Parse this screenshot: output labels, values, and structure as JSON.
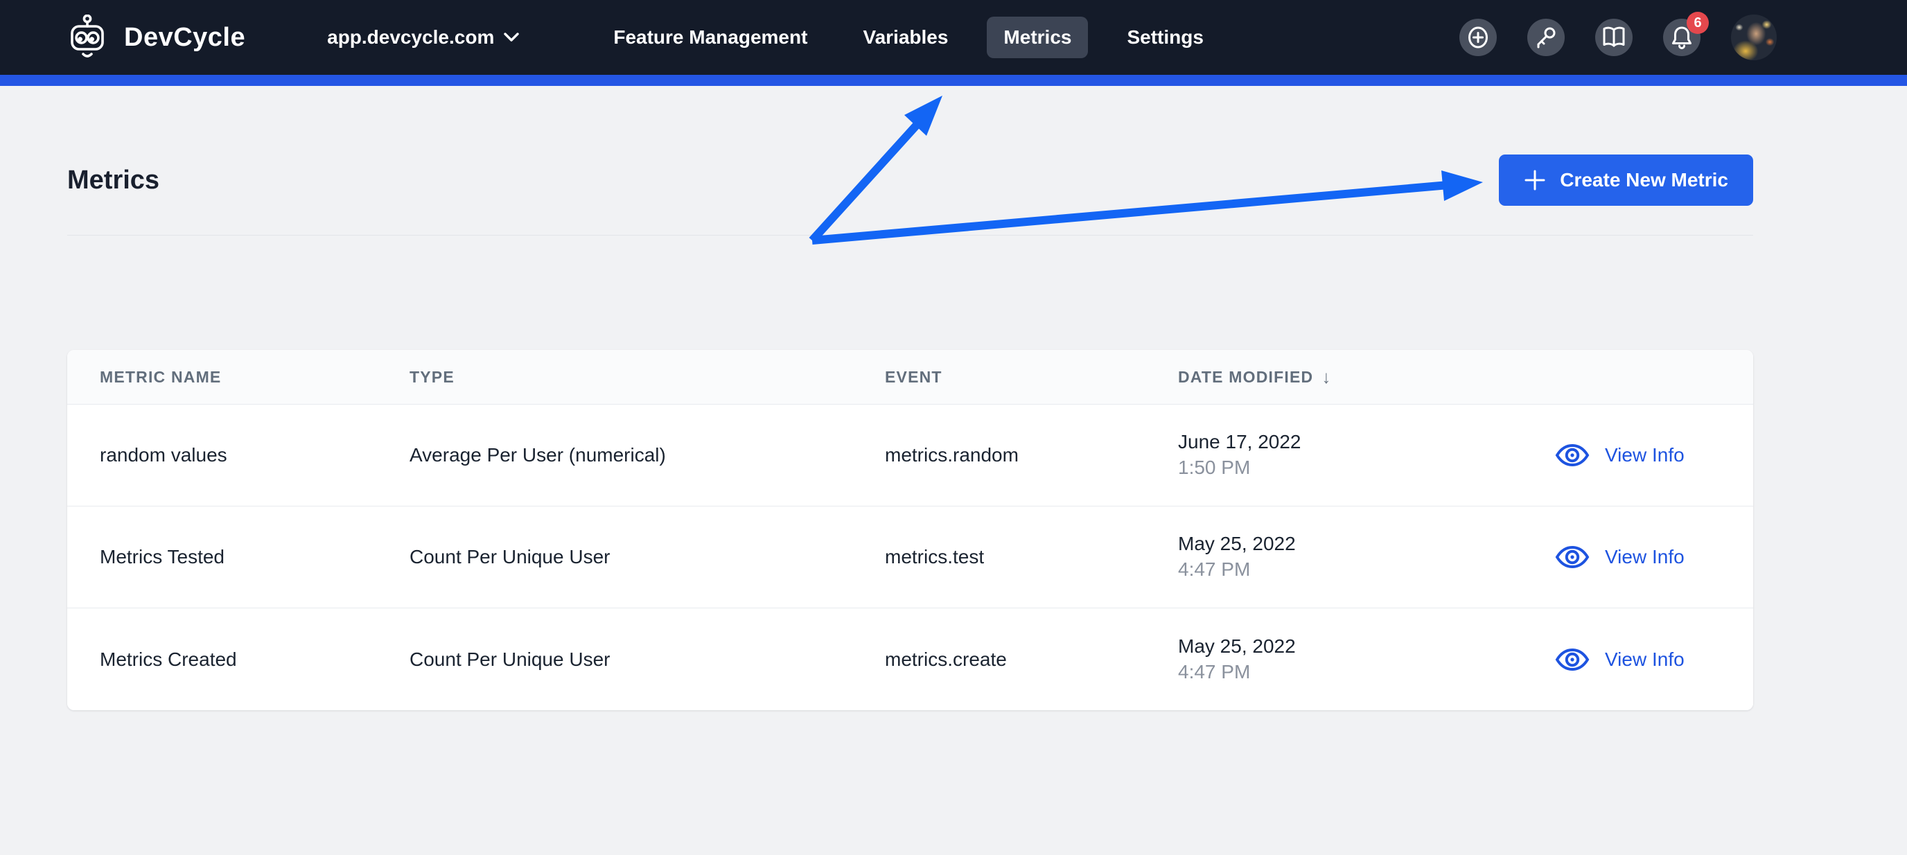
{
  "navbar": {
    "brand": "DevCycle",
    "org_switcher": {
      "label": "app.devcycle.com"
    },
    "items": [
      {
        "label": "Feature Management",
        "active": false
      },
      {
        "label": "Variables",
        "active": false
      },
      {
        "label": "Metrics",
        "active": true
      },
      {
        "label": "Settings",
        "active": false
      }
    ],
    "action_icons": [
      {
        "name": "add-circle-icon"
      },
      {
        "name": "api-key-icon"
      },
      {
        "name": "docs-book-icon"
      },
      {
        "name": "notifications-bell-icon",
        "badge": "6"
      }
    ],
    "notification_badge": "6"
  },
  "page": {
    "title": "Metrics",
    "create_button": {
      "label": "Create New Metric",
      "icon": "plus-icon"
    }
  },
  "table": {
    "headers": [
      "METRIC NAME",
      "TYPE",
      "EVENT",
      "DATE MODIFIED"
    ],
    "sort": {
      "column": "DATE MODIFIED",
      "direction": "desc",
      "glyph": "↓"
    },
    "rows": [
      {
        "name": "random values",
        "type": "Average Per User (numerical)",
        "event": "metrics.random",
        "date": "June 17, 2022",
        "time": "1:50 PM",
        "action": "View Info"
      },
      {
        "name": "Metrics Tested",
        "type": "Count Per Unique User",
        "event": "metrics.test",
        "date": "May 25, 2022",
        "time": "4:47 PM",
        "action": "View Info"
      },
      {
        "name": "Metrics Created",
        "type": "Count Per Unique User",
        "event": "metrics.create",
        "date": "May 25, 2022",
        "time": "4:47 PM",
        "action": "View Info"
      }
    ]
  },
  "colors": {
    "navbar_bg": "#141b29",
    "accent_bar": "#2456e4",
    "primary_blue": "#2563eb",
    "arrow_blue": "#1365f4",
    "link_blue": "#1d53e0",
    "badge_red": "#e5484d",
    "page_bg": "#f1f2f4"
  }
}
